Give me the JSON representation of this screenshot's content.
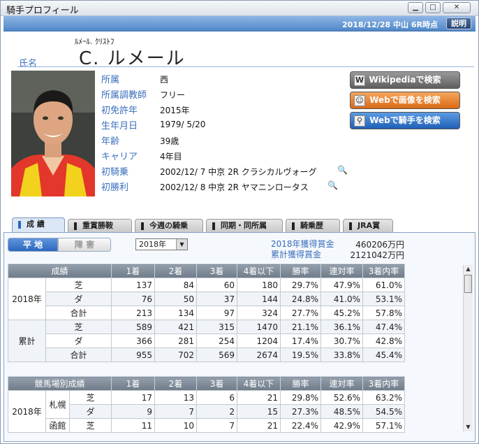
{
  "window": {
    "title": "騎手プロフィール"
  },
  "infobar": {
    "datetime": "2018/12/28 中山 6R時点",
    "explain_label": "説明"
  },
  "name": {
    "label": "氏名",
    "kana": "ﾙﾒｰﾙ. ｸﾘｽﾄﾌ",
    "full": "C. ルメール"
  },
  "profile": [
    {
      "label": "所属",
      "value": "西"
    },
    {
      "label": "所属調教師",
      "value": "フリー"
    },
    {
      "label": "初免許年",
      "value": "2015年"
    },
    {
      "label": "生年月日",
      "value": "1979/ 5/20"
    },
    {
      "label": "年齢",
      "value": "39歳"
    },
    {
      "label": "キャリア",
      "value": "4年目"
    },
    {
      "label": "初騎乗",
      "value": "2002/12/ 7 中京 2R クラシカルヴォーグ"
    },
    {
      "label": "初勝利",
      "value": "2002/12/ 8 中京 2R ヤマニンロータス"
    }
  ],
  "search_buttons": [
    {
      "label": "Wikipediaで検索",
      "icon": "wikipedia-icon",
      "color": "#6f6f6f"
    },
    {
      "label": "Webで画像を検索",
      "icon": "person-image-icon",
      "color": "#e07a2a"
    },
    {
      "label": "Webで騎手を検索",
      "icon": "magnifier-icon",
      "color": "#2f73c9"
    }
  ],
  "tabs": [
    "成 績",
    "重賞勝鞍",
    "今週の騎乗",
    "同期・同所属",
    "騎乗歴",
    "JRA賞"
  ],
  "surface_toggle": {
    "left": "平 地",
    "right": "障 害"
  },
  "year_select": {
    "value": "2018年"
  },
  "prize": [
    {
      "label": "2018年獲得賞金",
      "value": "460206万円"
    },
    {
      "label": "累計獲得賞金",
      "value": "2121042万円"
    }
  ],
  "results_table": {
    "headers": [
      "成績",
      "1着",
      "2着",
      "3着",
      "4着以下",
      "勝率",
      "連対率",
      "3着内率"
    ],
    "groups": [
      {
        "name": "2018年",
        "rows": [
          [
            "芝",
            "137",
            "84",
            "60",
            "180",
            "29.7%",
            "47.9%",
            "61.0%"
          ],
          [
            "ダ",
            "76",
            "50",
            "37",
            "144",
            "24.8%",
            "41.0%",
            "53.1%"
          ],
          [
            "合計",
            "213",
            "134",
            "97",
            "324",
            "27.7%",
            "45.2%",
            "57.8%"
          ]
        ]
      },
      {
        "name": "累計",
        "rows": [
          [
            "芝",
            "589",
            "421",
            "315",
            "1470",
            "21.1%",
            "36.1%",
            "47.4%"
          ],
          [
            "ダ",
            "366",
            "281",
            "254",
            "1204",
            "17.4%",
            "30.7%",
            "42.8%"
          ],
          [
            "合計",
            "955",
            "702",
            "569",
            "2674",
            "19.5%",
            "33.8%",
            "45.4%"
          ]
        ]
      }
    ]
  },
  "course_table": {
    "headers": [
      "競馬場別成績",
      "1着",
      "2着",
      "3着",
      "4着以下",
      "勝率",
      "連対率",
      "3着内率"
    ],
    "year": "2018年",
    "rows": [
      {
        "course": "札幌",
        "surface": "芝",
        "cells": [
          "17",
          "13",
          "6",
          "21",
          "29.8%",
          "52.6%",
          "63.2%"
        ]
      },
      {
        "course": "",
        "surface": "ダ",
        "cells": [
          "9",
          "7",
          "2",
          "15",
          "27.3%",
          "48.5%",
          "54.5%"
        ]
      },
      {
        "course": "函館",
        "surface": "芝",
        "cells": [
          "11",
          "10",
          "7",
          "21",
          "22.4%",
          "42.9%",
          "57.1%"
        ]
      }
    ]
  }
}
